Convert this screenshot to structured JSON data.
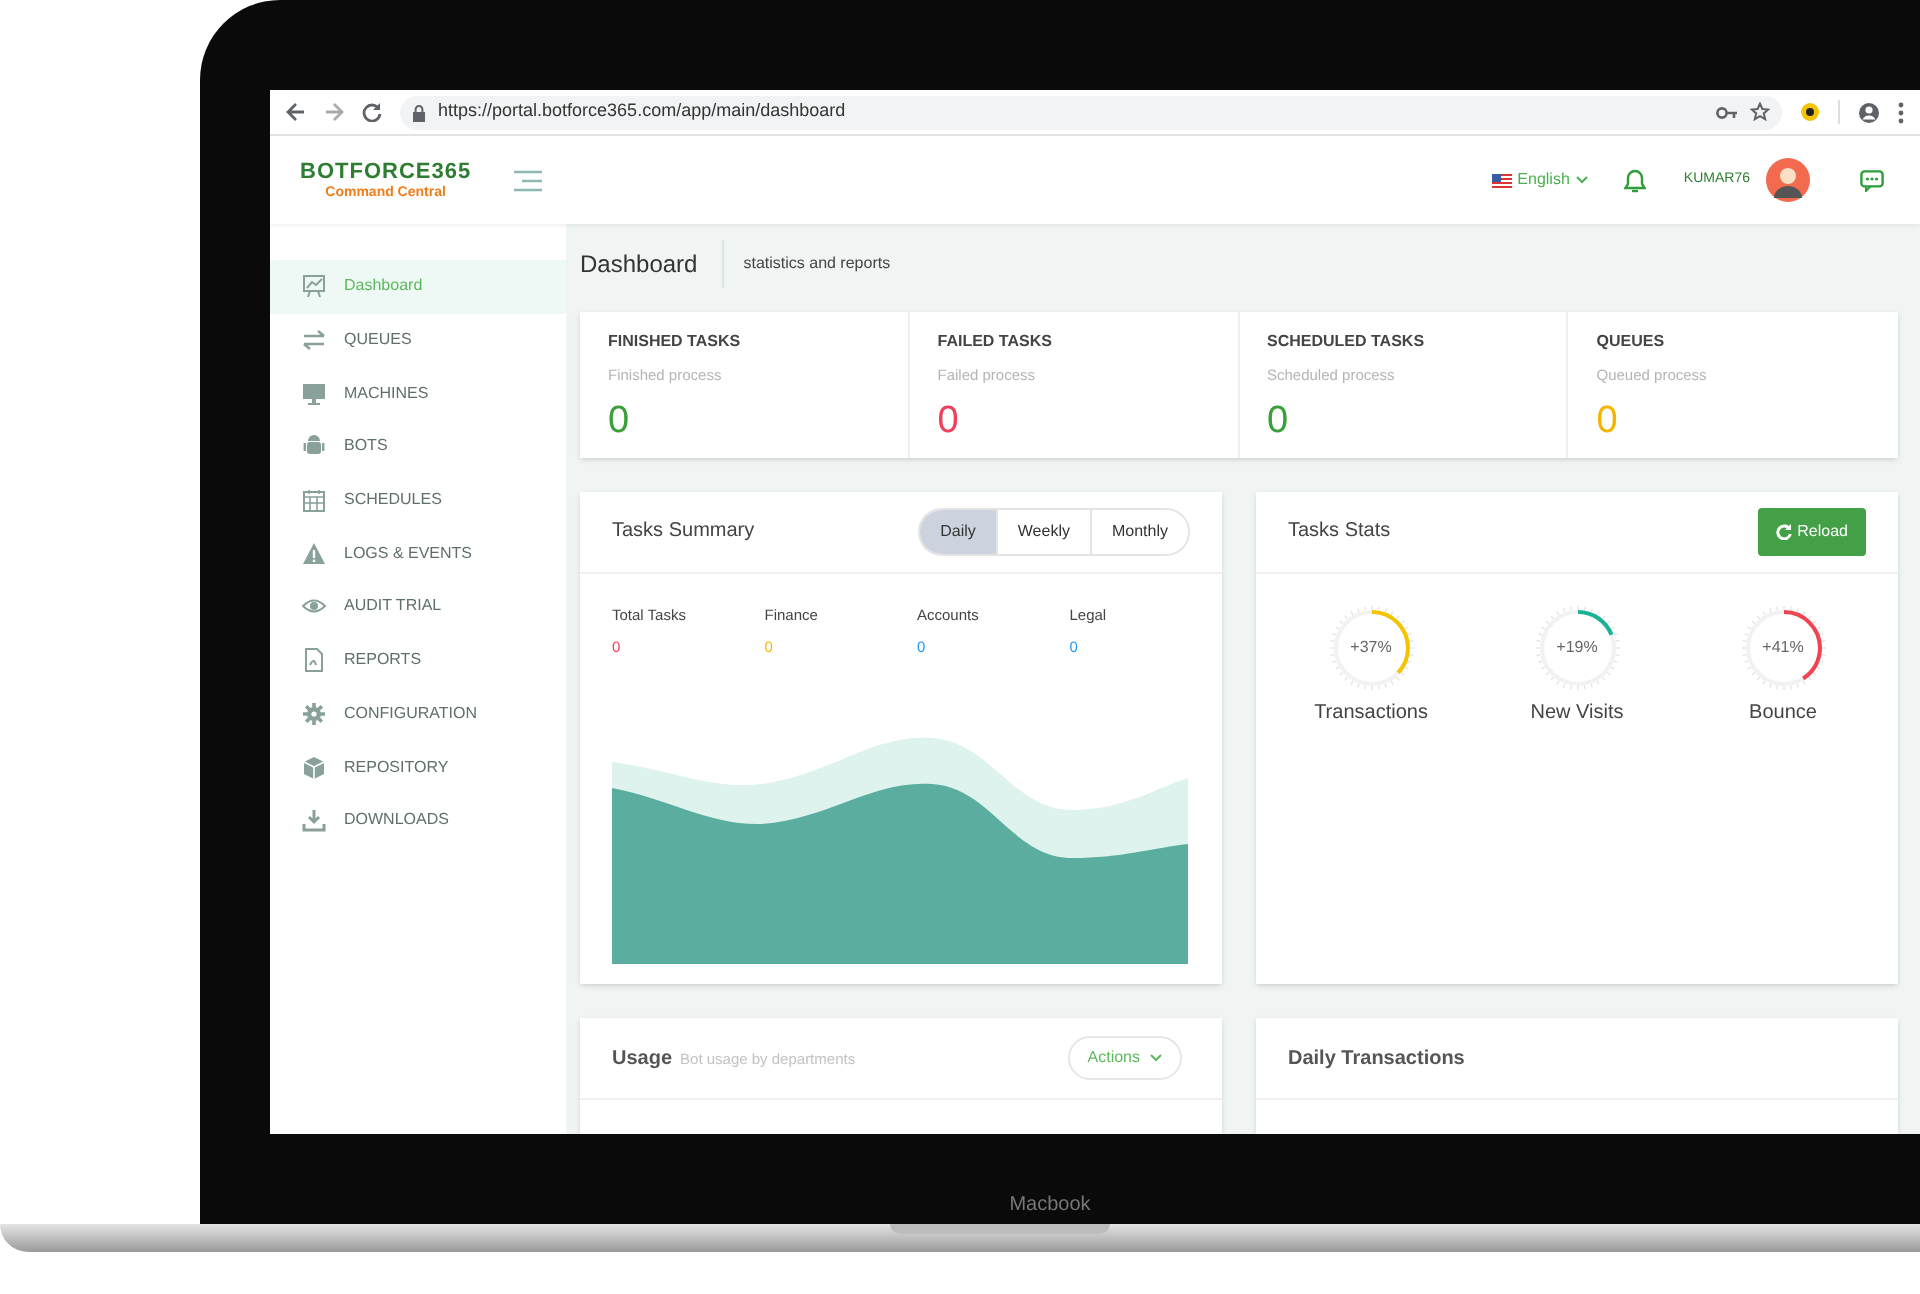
{
  "browser": {
    "url": "https://portal.botforce365.com/app/main/dashboard"
  },
  "header": {
    "logo_title": "BOTFORCE365",
    "logo_subtitle": "Command Central",
    "language": "English",
    "username": "KUMAR76"
  },
  "sidebar": {
    "items": [
      {
        "label": "Dashboard",
        "selected": true
      },
      {
        "label": "QUEUES",
        "selected": false
      },
      {
        "label": "MACHINES",
        "selected": false
      },
      {
        "label": "BOTS",
        "selected": false
      },
      {
        "label": "SCHEDULES",
        "selected": false
      },
      {
        "label": "LOGS & EVENTS",
        "selected": false
      },
      {
        "label": "AUDIT TRIAL",
        "selected": false
      },
      {
        "label": "REPORTS",
        "selected": false
      },
      {
        "label": "CONFIGURATION",
        "selected": false
      },
      {
        "label": "REPOSITORY",
        "selected": false
      },
      {
        "label": "DOWNLOADS",
        "selected": false
      }
    ]
  },
  "page": {
    "title": "Dashboard",
    "subtitle": "statistics and reports"
  },
  "stats": [
    {
      "title": "FINISHED TASKS",
      "caption": "Finished process",
      "value": "0",
      "color": "#3aa13a"
    },
    {
      "title": "FAILED TASKS",
      "caption": "Failed process",
      "value": "0",
      "color": "#f0405a"
    },
    {
      "title": "SCHEDULED TASKS",
      "caption": "Scheduled process",
      "value": "0",
      "color": "#3aa13a"
    },
    {
      "title": "QUEUES",
      "caption": "Queued process",
      "value": "0",
      "color": "#f5b400"
    }
  ],
  "tasks_summary": {
    "title": "Tasks Summary",
    "tabs": [
      {
        "label": "Daily",
        "selected": true
      },
      {
        "label": "Weekly",
        "selected": false
      },
      {
        "label": "Monthly",
        "selected": false
      }
    ],
    "legend": [
      {
        "label": "Total Tasks",
        "value": "0",
        "color": "#f0405a"
      },
      {
        "label": "Finance",
        "value": "0",
        "color": "#f5b400"
      },
      {
        "label": "Accounts",
        "value": "0",
        "color": "#2196f3"
      },
      {
        "label": "Legal",
        "value": "0",
        "color": "#2196f3"
      }
    ]
  },
  "tasks_stats": {
    "title": "Tasks Stats",
    "reload": "Reload",
    "gauges": [
      {
        "reading": "+37%",
        "label": "Transactions",
        "level": 0.37,
        "color": "#f5c400"
      },
      {
        "reading": "+19%",
        "label": "New Visits",
        "level": 0.19,
        "color": "#1ab394"
      },
      {
        "reading": "+41%",
        "label": "Bounce",
        "level": 0.41,
        "color": "#ef4450"
      }
    ]
  },
  "usage": {
    "title": "Usage",
    "subtitle": "Bot usage by departments",
    "actions": "Actions"
  },
  "daily_transactions": {
    "title": "Daily Transactions"
  },
  "laptop": {
    "label": "Macbook"
  }
}
